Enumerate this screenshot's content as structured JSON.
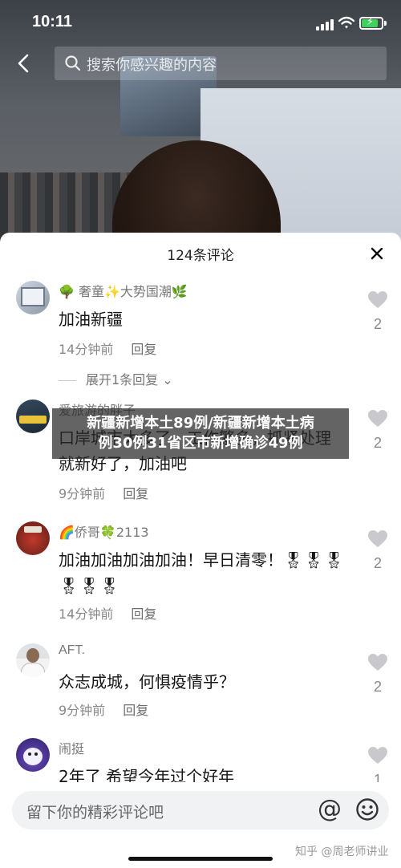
{
  "status_bar": {
    "time": "10:11"
  },
  "search": {
    "placeholder": "搜索你感兴趣的内容"
  },
  "sheet": {
    "title": "124条评论"
  },
  "comments": [
    {
      "username": "🌳 奢童✨大势国潮🌿",
      "text": "加油新疆",
      "time": "14分钟前",
      "reply_label": "回复",
      "likes": "2",
      "expand_label": "展开1条回复"
    },
    {
      "username": "爱旅游的胖子",
      "text": "口岸城市太多了，工作繁多，抓紧处理就新好了，加油吧",
      "time": "9分钟前",
      "reply_label": "回复",
      "likes": "2"
    },
    {
      "username": "🌈侨哥🍀2113",
      "text": "加油加油加油加油！早日清零！🎖🎖🎖🎖🎖🎖",
      "time": "14分钟前",
      "reply_label": "回复",
      "likes": "2"
    },
    {
      "username": "AFT.",
      "text": "众志成城，何惧疫情乎？",
      "time": "9分钟前",
      "reply_label": "回复",
      "likes": "2"
    },
    {
      "username": "闹挺",
      "text": "2年了 希望今年过个好年",
      "likes": "1"
    }
  ],
  "headline": {
    "line1": "新疆新增本土89例/新疆新增本土病",
    "line2": "例30例31省区市新增确诊49例"
  },
  "input": {
    "placeholder": "留下你的精彩评论吧"
  },
  "watermark": "知乎 @周老师讲业",
  "colors": {
    "battery_fill": "#3fd15b",
    "heart": "#c9c9cd"
  }
}
